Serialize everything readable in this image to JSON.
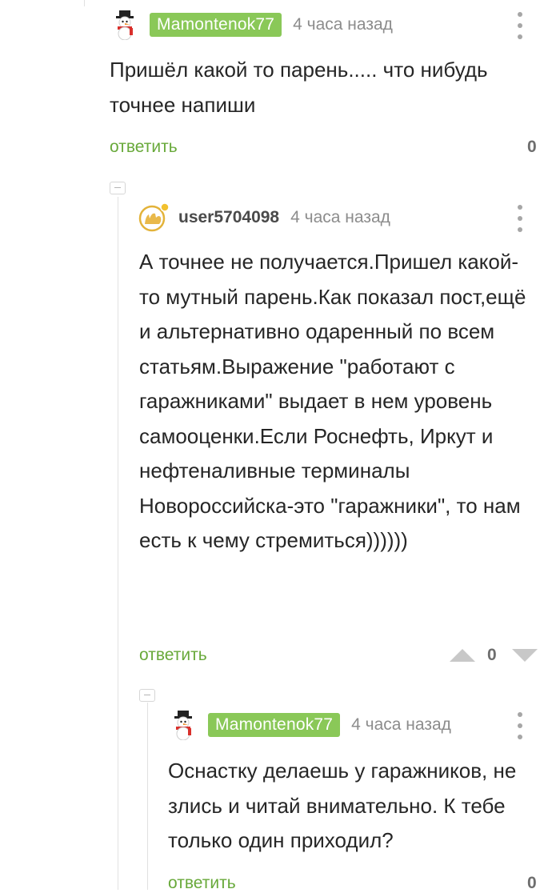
{
  "comments": [
    {
      "author": "Mamontenok77",
      "time": "4 часа назад",
      "text": "Пришёл какой то парень..... что нибудь точнее напиши",
      "reply_label": "ответить",
      "rating": "0",
      "avatar_icon": "snowman-icon"
    },
    {
      "author": "user5704098",
      "time": "4 часа назад",
      "text": "А точнее не получается.Пришел какой-то мутный парень.Как показал пост,ещё и альтернативно одаренный по всем статьям.Выражение \"работают с гаражниками\" выдает в нем уровень самооценки.Если Роснефть, Иркут и нефтеналивные терминалы Новороссийска-это \"гаражники\", то нам есть к чему стремиться))))))",
      "reply_label": "ответить",
      "rating": "0",
      "avatar_icon": "default-avatar-icon"
    },
    {
      "author": "Mamontenok77",
      "time": "4 часа назад",
      "text": "Оснастку делаешь у гаражников, не злись и читай внимательно. К тебе только один приходил?",
      "reply_label": "ответить",
      "rating": "0",
      "avatar_icon": "snowman-icon"
    }
  ],
  "colors": {
    "author_badge": "#8ac858",
    "reply_link": "#68a93a",
    "muted": "#8c8c8c"
  }
}
